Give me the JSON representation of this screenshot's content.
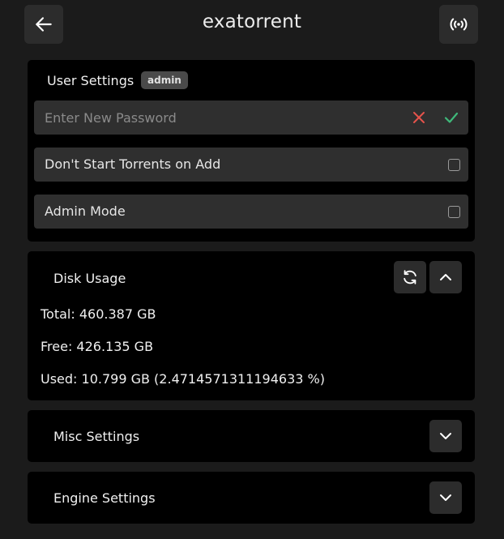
{
  "header": {
    "title": "exatorrent",
    "back_icon": "arrow-left-icon",
    "signal_icon": "broadcast-signal-icon"
  },
  "user_settings": {
    "heading": "User Settings",
    "badge": "admin",
    "password": {
      "placeholder": "Enter New Password",
      "value": "",
      "clear_icon": "x-icon",
      "confirm_icon": "check-icon",
      "clear_color": "#e5534b",
      "confirm_color": "#3fb97a"
    },
    "options": [
      {
        "label": "Don't Start Torrents on Add",
        "checked": false
      },
      {
        "label": "Admin Mode",
        "checked": false
      }
    ]
  },
  "disk_usage": {
    "heading": "Disk Usage",
    "refresh_icon": "refresh-icon",
    "collapse_icon": "chevron-up-icon",
    "total": "Total: 460.387 GB",
    "free": "Free: 426.135 GB",
    "used": "Used: 10.799 GB (2.4714571311194633 %)"
  },
  "misc_settings": {
    "heading": "Misc Settings",
    "expand_icon": "chevron-down-icon"
  },
  "engine_settings": {
    "heading": "Engine Settings",
    "expand_icon": "chevron-down-icon"
  },
  "colors": {
    "background": "#1b1b1b",
    "card": "#000000",
    "row": "#2f2f2f",
    "button": "#2c2c2c"
  }
}
